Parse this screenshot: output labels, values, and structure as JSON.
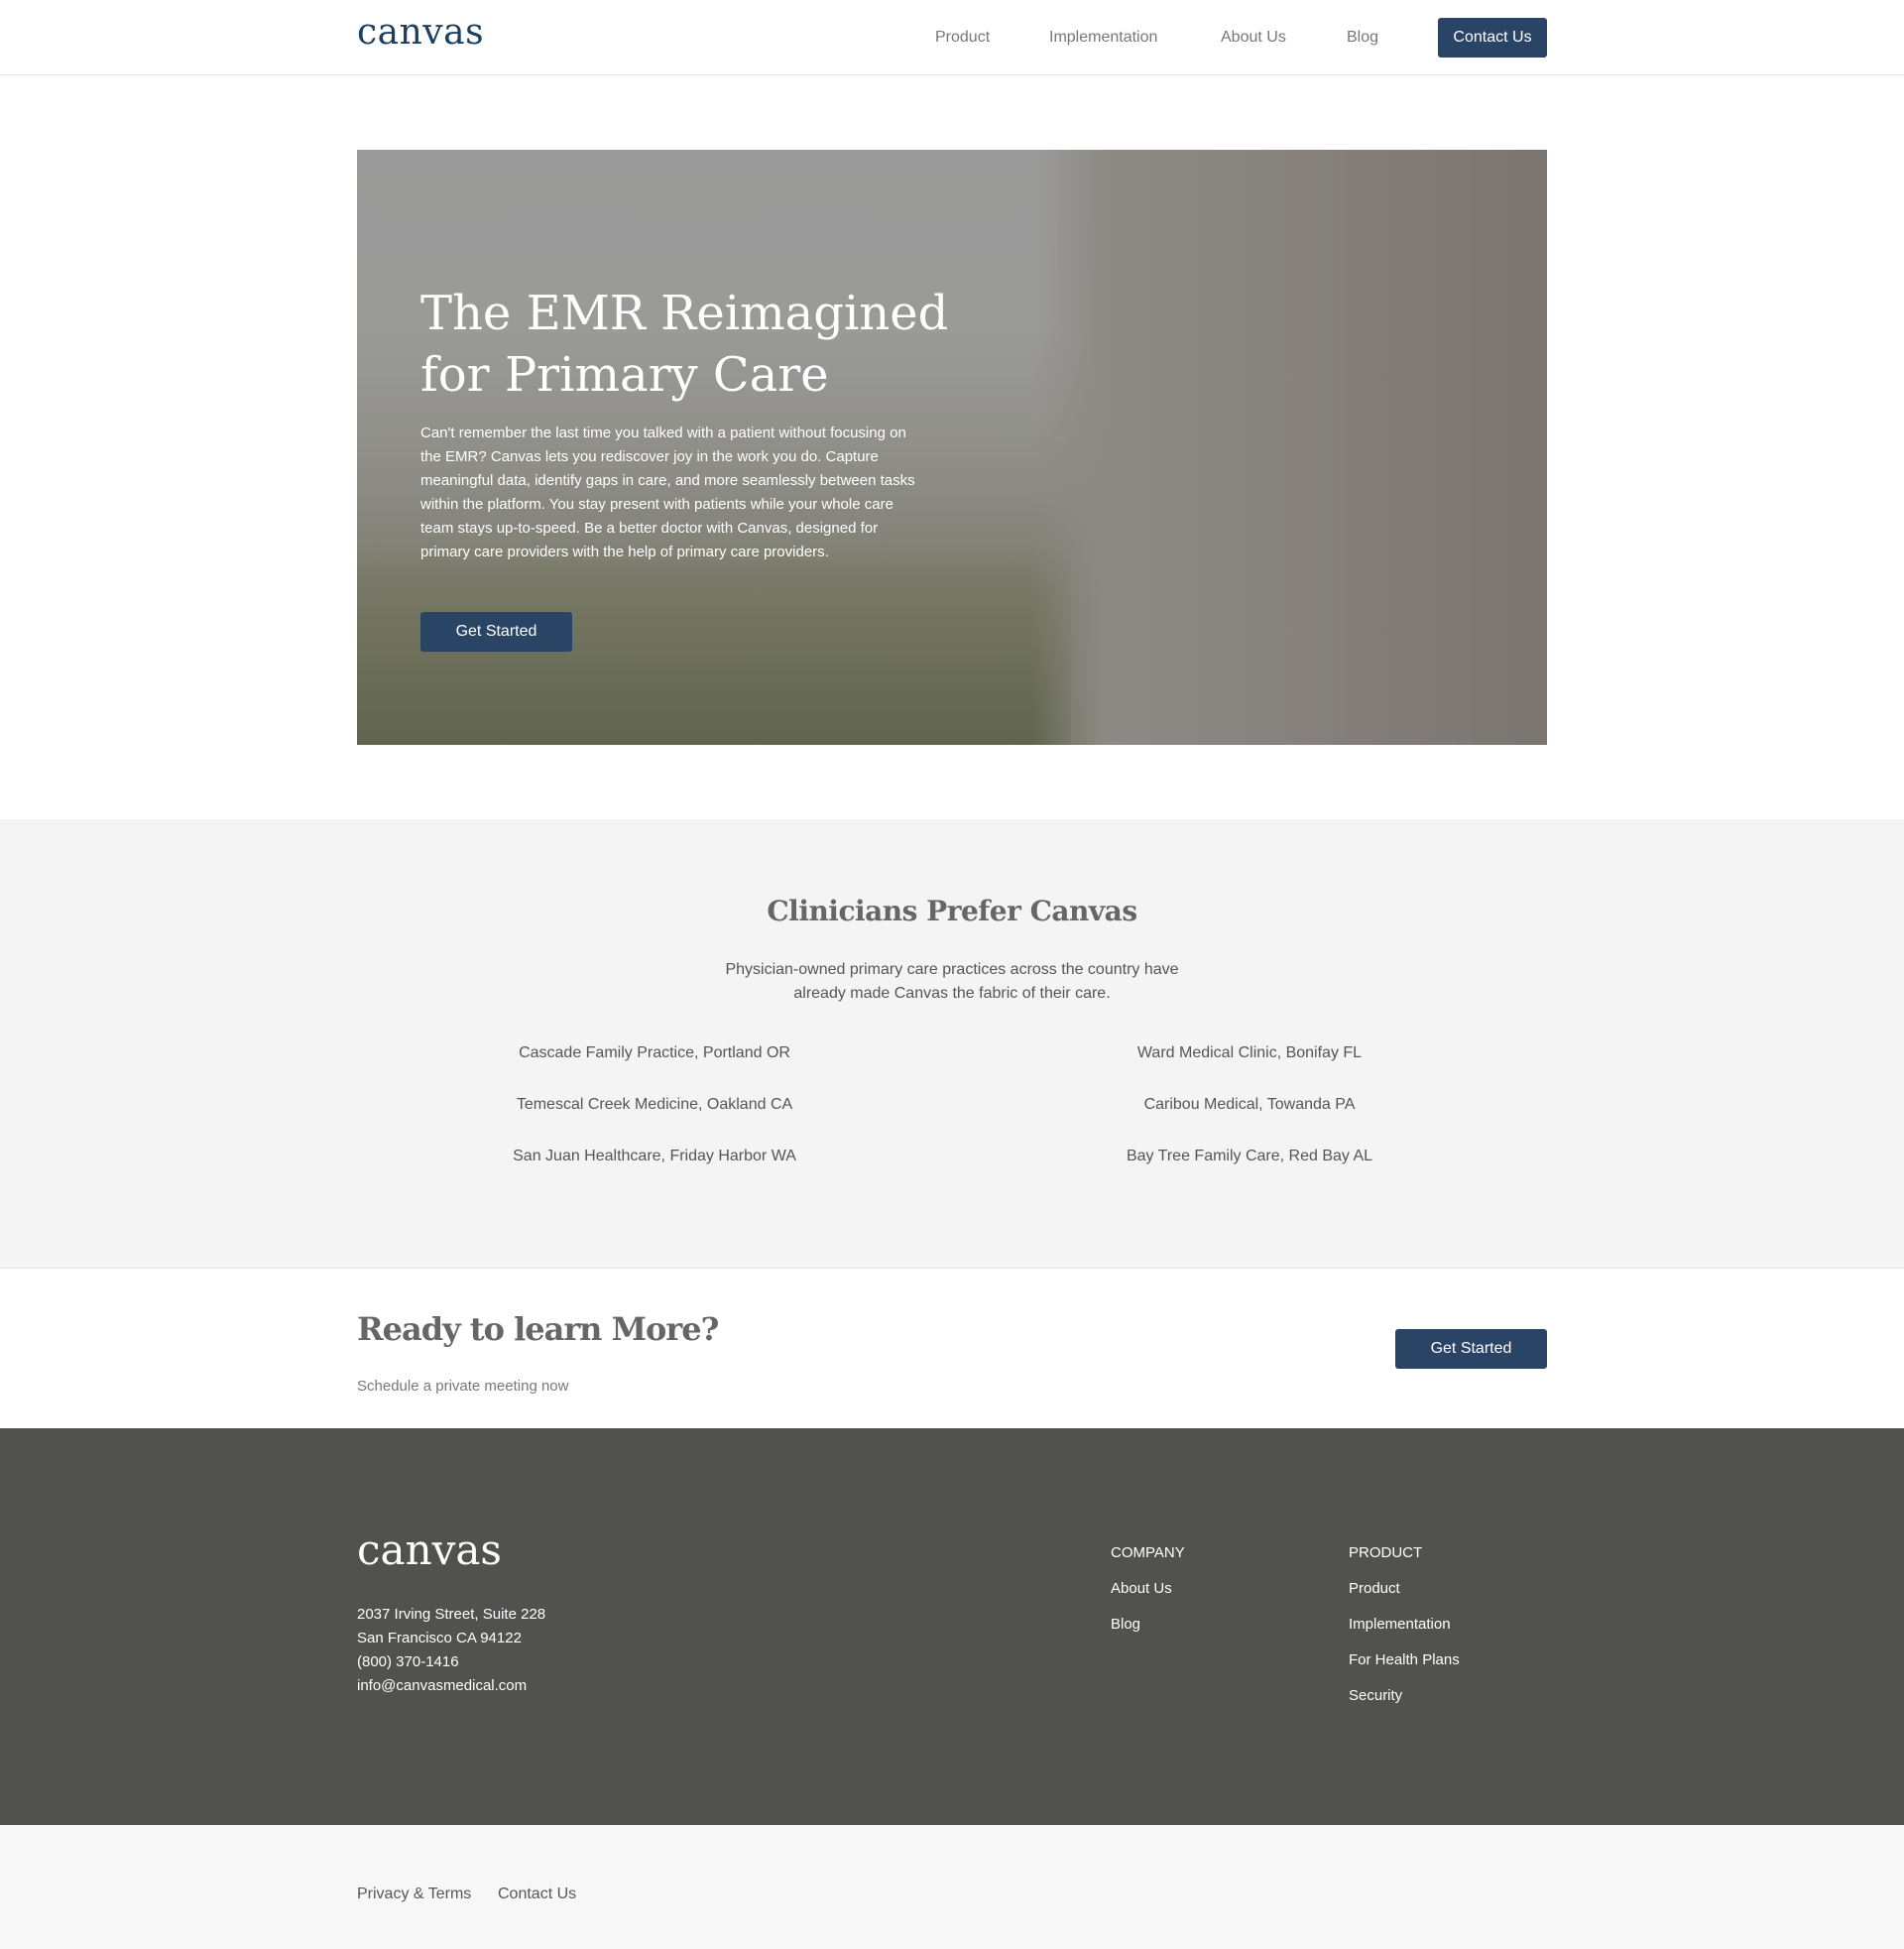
{
  "header": {
    "logo": "canvas",
    "nav": [
      "Product",
      "Implementation",
      "About Us",
      "Blog"
    ],
    "contact_label": "Contact Us"
  },
  "hero": {
    "title": "The EMR Reimagined for Primary Care",
    "body": "Can't remember the last time you talked with a patient without focusing on the EMR? Canvas lets you rediscover joy in the work you do. Capture meaningful data, identify gaps in care, and more seamlessly between tasks within the platform. You stay present with patients while your whole care team stays up-to-speed. Be a better doctor with Canvas, designed for primary care providers with the help of primary care providers.",
    "button_label": "Get Started"
  },
  "prefer": {
    "title": "Clinicians Prefer Canvas",
    "subtitle": "Physician-owned primary care practices across the country have already made Canvas the fabric of their care.",
    "clinics_left": [
      "Cascade Family Practice, Portland OR",
      "Temescal Creek Medicine, Oakland CA",
      "San Juan Healthcare, Friday Harbor WA"
    ],
    "clinics_right": [
      "Ward Medical Clinic, Bonifay FL",
      "Caribou Medical, Towanda PA",
      "Bay Tree Family Care, Red Bay AL"
    ]
  },
  "cta": {
    "title": "Ready to learn More?",
    "subtitle": "Schedule a private meeting now",
    "button_label": "Get Started"
  },
  "footer": {
    "logo": "canvas",
    "address": [
      "2037 Irving Street, Suite 228",
      "San Francisco CA 94122",
      "(800) 370-1416",
      "info@canvasmedical.com"
    ],
    "company_title": "COMPANY",
    "company_links": [
      "About Us",
      "Blog"
    ],
    "product_title": "PRODUCT",
    "product_links": [
      "Product",
      "Implementation",
      "For Health Plans",
      "Security"
    ]
  },
  "bottom": {
    "privacy": "Privacy & Terms",
    "contact": "Contact Us"
  },
  "colors": {
    "brand_navy": "#2a4466",
    "logo_blue": "#1d3f5f",
    "footer_bg": "#515150"
  }
}
